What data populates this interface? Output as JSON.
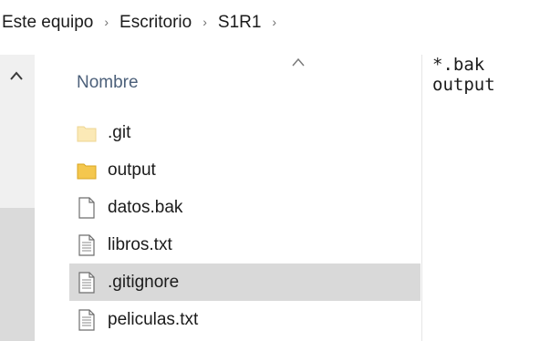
{
  "breadcrumb": {
    "items": [
      "Este equipo",
      "Escritorio",
      "S1R1"
    ],
    "separator": "›"
  },
  "column_header": {
    "name_label": "Nombre"
  },
  "files": [
    {
      "name": ".git",
      "icon": "folder-hidden-icon",
      "selected": false
    },
    {
      "name": "output",
      "icon": "folder-icon",
      "selected": false
    },
    {
      "name": "datos.bak",
      "icon": "blank-file-icon",
      "selected": false
    },
    {
      "name": "libros.txt",
      "icon": "text-file-icon",
      "selected": false
    },
    {
      "name": ".gitignore",
      "icon": "text-file-icon",
      "selected": true
    },
    {
      "name": "peliculas.txt",
      "icon": "text-file-icon",
      "selected": false
    }
  ],
  "preview": {
    "lines": [
      "*.bak",
      "output"
    ]
  },
  "colors": {
    "selection": "#d9d9d9",
    "folder": "#f4c74e",
    "folder_hidden": "#fbe9b6",
    "header_text": "#4c607a"
  }
}
